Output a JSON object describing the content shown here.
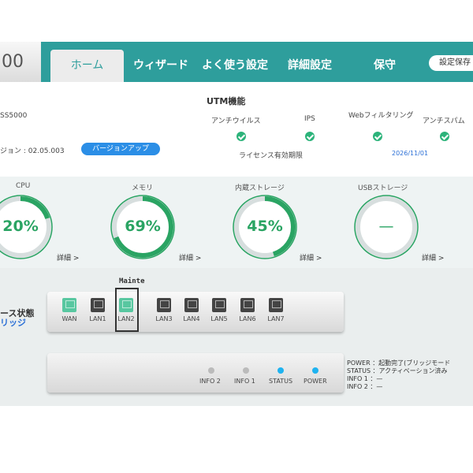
{
  "header": {
    "brand": "00",
    "tabs": [
      "ホーム",
      "ウィザード",
      "よく使う設定",
      "詳細設定",
      "保守"
    ],
    "save_button": "設定保存"
  },
  "device": {
    "model": "SS5000",
    "version_label": "ジョン : 02.05.003",
    "version_up_button": "バージョンアップ"
  },
  "utm": {
    "title": "UTM機能",
    "columns": [
      "アンチウイルス",
      "IPS",
      "Webフィルタリング",
      "アンチスパム"
    ],
    "license_label": "ライセンス有効期限",
    "license_date": "2026/11/01"
  },
  "gauges": [
    {
      "label": "CPU",
      "value": "20%",
      "percent": 20,
      "detail": "詳細 >"
    },
    {
      "label": "メモリ",
      "value": "69%",
      "percent": 69,
      "detail": "詳細 >"
    },
    {
      "label": "内蔵ストレージ",
      "value": "45%",
      "percent": 45,
      "detail": "詳細 >"
    },
    {
      "label": "USBストレージ",
      "value": "—",
      "percent": 0,
      "detail": "詳細 >"
    }
  ],
  "interfaces": {
    "title": "ース状態",
    "subtitle": "リッジ",
    "mainte_label": "Mainte",
    "ports": [
      {
        "label": "WAN",
        "active": true
      },
      {
        "label": "LAN1",
        "active": false
      },
      {
        "label": "LAN2",
        "active": true
      },
      {
        "label": "LAN3",
        "active": false
      },
      {
        "label": "LAN4",
        "active": false
      },
      {
        "label": "LAN5",
        "active": false
      },
      {
        "label": "LAN6",
        "active": false
      },
      {
        "label": "LAN7",
        "active": false
      }
    ]
  },
  "leds": [
    {
      "label": "INFO 2",
      "color": "#bbbbbb"
    },
    {
      "label": "INFO 1",
      "color": "#bbbbbb"
    },
    {
      "label": "STATUS",
      "color": "#1fb3f0"
    },
    {
      "label": "POWER",
      "color": "#1fb3f0"
    }
  ],
  "legend": [
    "POWER ：起動完了(ブリッジモード",
    "STATUS ：アクティベーション済み",
    "INFO 1 ：—",
    "INFO 2 ：—"
  ],
  "colors": {
    "accent": "#2e9e9c",
    "gauge": "#2aa463",
    "port_active": "#58c7a0",
    "port_inactive": "#444444"
  }
}
